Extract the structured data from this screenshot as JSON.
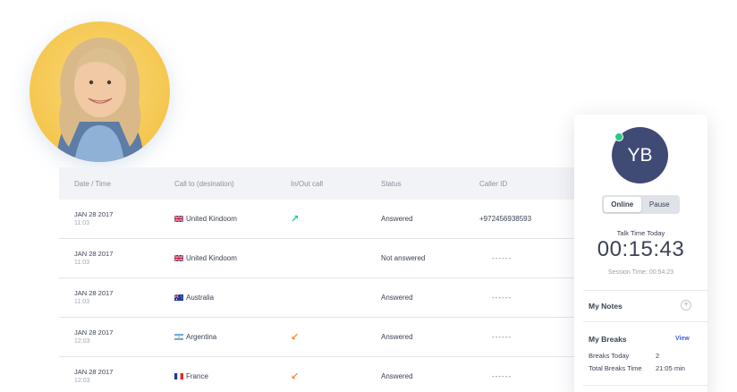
{
  "table": {
    "headers": [
      "Date / Time",
      "Call to (desination)",
      "In/Out call",
      "Status",
      "Caller ID"
    ],
    "rows": [
      {
        "date": "JAN 28 2017",
        "time": "11:03",
        "flag": "uk",
        "country": "United Kindoom",
        "direction": "out",
        "direction_glyph": "↗",
        "status": "Answered",
        "caller_id": "+972456938593"
      },
      {
        "date": "JAN 28 2017",
        "time": "11:03",
        "flag": "uk",
        "country": "United Kindoom",
        "direction": "",
        "direction_glyph": "",
        "status": "Not answered",
        "caller_id": "------"
      },
      {
        "date": "JAN 28 2017",
        "time": "11:03",
        "flag": "au",
        "country": "Australia",
        "direction": "",
        "direction_glyph": "",
        "status": "Answered",
        "caller_id": "------"
      },
      {
        "date": "JAN 28 2017",
        "time": "12:03",
        "flag": "ar",
        "country": "Argentina",
        "direction": "in",
        "direction_glyph": "↙",
        "status": "Answered",
        "caller_id": "------"
      },
      {
        "date": "JAN 28 2017",
        "time": "12:03",
        "flag": "fr",
        "country": "France",
        "direction": "in",
        "direction_glyph": "↙",
        "status": "Answered",
        "caller_id": "------"
      }
    ]
  },
  "panel": {
    "initials": "YB",
    "status_online": "Online",
    "status_pause": "Pause",
    "talk_time_label": "Talk Time Today",
    "talk_time": "00:15:43",
    "session_time": "Session Time: 00:54:23",
    "notes_title": "My Notes",
    "breaks_title": "My Breaks",
    "view_label": "View",
    "breaks_today_label": "Breaks Today",
    "breaks_today_value": "2",
    "total_breaks_label": "Total Breaks Time",
    "total_breaks_value": "21:05 min"
  },
  "colors": {
    "accent": "#3d63d8",
    "avatar_bg": "#3f4a75",
    "online_dot": "#2cc982",
    "outgoing": "#22c7a4",
    "incoming": "#f28c4a"
  }
}
